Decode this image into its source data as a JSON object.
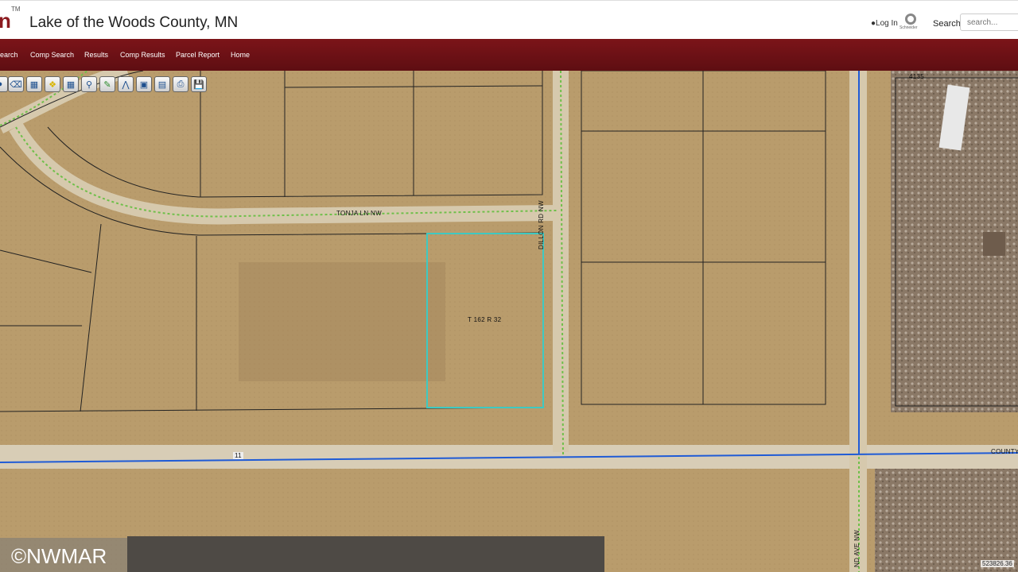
{
  "header": {
    "logo_fragment": "n",
    "logo_tm": "TM",
    "title": "Lake of the Woods County, MN",
    "login_label": "Log In",
    "brand_text": "Schneider",
    "search_label": "Search",
    "search_placeholder": "search..."
  },
  "nav": {
    "items": [
      {
        "label": "earch"
      },
      {
        "label": "Comp Search"
      },
      {
        "label": "Results"
      },
      {
        "label": "Comp Results"
      },
      {
        "label": "Parcel Report"
      },
      {
        "label": "Home"
      }
    ]
  },
  "toolbar": {
    "tools": [
      {
        "icon": "partial-tool-icon"
      },
      {
        "icon": "eraser-icon"
      },
      {
        "icon": "select-parcel-icon"
      },
      {
        "icon": "identify-icon"
      },
      {
        "icon": "buffer-icon"
      },
      {
        "icon": "zoom-icon"
      },
      {
        "icon": "measure-line-icon"
      },
      {
        "icon": "measure-area-icon"
      },
      {
        "icon": "full-extent-icon"
      },
      {
        "icon": "layers-icon"
      },
      {
        "icon": "print-icon"
      },
      {
        "icon": "save-icon"
      }
    ]
  },
  "map": {
    "labels": {
      "road_tonja": "TONJA LN NW",
      "road_dillon": "DILLON RD NW",
      "road_county": "COUNTY",
      "road_bottom": "ND AVE NW",
      "parcel_label": "T 162 R 32",
      "parcel_number": "4135",
      "marker_11": "11"
    },
    "coordinate_readout": "523826.36"
  },
  "watermark": "©NWMAR",
  "colors": {
    "brand_red": "#7c1419",
    "selected_parcel": "#3ec9c2",
    "road_line": "#1f5bd6",
    "road_dotted": "#6fbf4a"
  }
}
